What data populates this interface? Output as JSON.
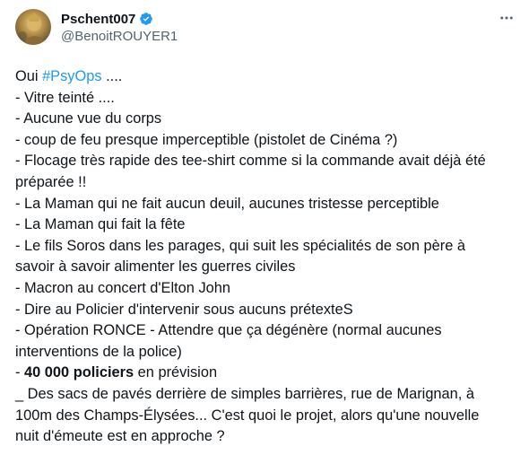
{
  "author": {
    "display_name": "Pschent007",
    "handle": "@BenoitROUYER1",
    "verified_color": "#1d9bf0",
    "avatar_icon": "avatar-image"
  },
  "menu": {
    "icon": "more-horizontal-icon"
  },
  "colors": {
    "text": "#0f1419",
    "secondary": "#536471",
    "accent": "#1d9bf0"
  },
  "tweet": {
    "intro_prefix": "Oui ",
    "hashtag": "#PsyOps",
    "intro_suffix": " ....",
    "lines": [
      "- Vitre teinté ....",
      "- Aucune vue du corps",
      "- coup de feu presque imperceptible (pistolet de Cinéma ?)",
      "- Flocage très rapide des tee-shirt comme si la commande avait déjà été",
      "préparée !!",
      "- La Maman qui ne fait aucun deuil, aucunes tristesse perceptible",
      "- La Maman qui fait la fête",
      "- Le fils Soros dans les parages, qui suit les spécialités de son père à",
      "savoir à savoir alimenter les guerres civiles",
      "- Macron au concert d'Elton John",
      "- Dire au Policier d'intervenir sous aucuns prétexteS",
      "- Opération RONCE - Attendre que ça dégénère (normal aucunes",
      "interventions de la police)"
    ],
    "bold_line_prefix": "- ",
    "bold_text": "40 000 policiers",
    "bold_line_suffix": " en prévision",
    "closing_lines": [
      "_  Des sacs de pavés derrière de simples barrières, rue de Marignan, à",
      "100m des Champs-Élysées... C'est quoi le projet, alors qu'une nouvelle",
      "nuit d'émeute est en approche ?"
    ]
  }
}
